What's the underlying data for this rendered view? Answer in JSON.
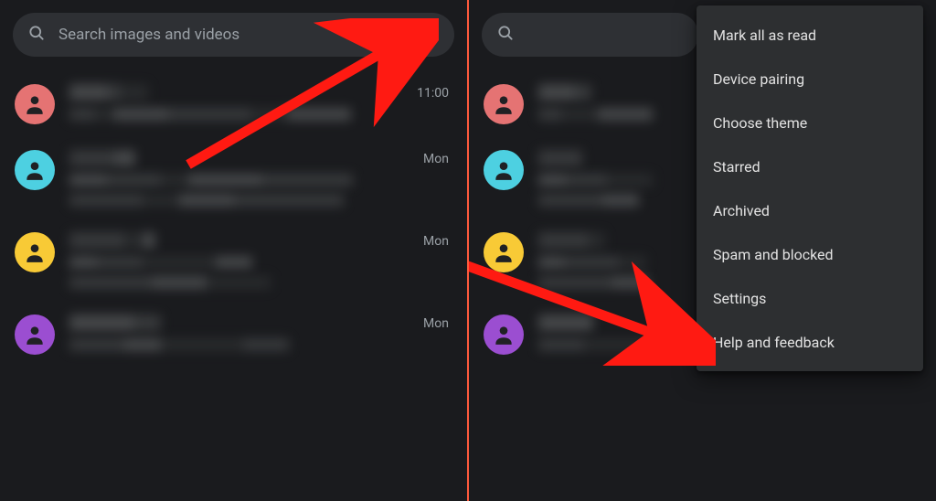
{
  "search": {
    "placeholder": "Search images and videos"
  },
  "conversations": [
    {
      "avatar_color": "#e57373",
      "time": "11:00"
    },
    {
      "avatar_color": "#4dd0e1",
      "time": "Mon"
    },
    {
      "avatar_color": "#f8ca36",
      "time": "Mon"
    },
    {
      "avatar_color": "#9b4ed1",
      "time": "Mon"
    }
  ],
  "menu": {
    "items": [
      "Mark all as read",
      "Device pairing",
      "Choose theme",
      "Starred",
      "Archived",
      "Spam and blocked",
      "Settings",
      "Help and feedback"
    ]
  },
  "annotations": {
    "arrow_color": "#ff1a12",
    "divider_color": "#ff5a3c"
  }
}
